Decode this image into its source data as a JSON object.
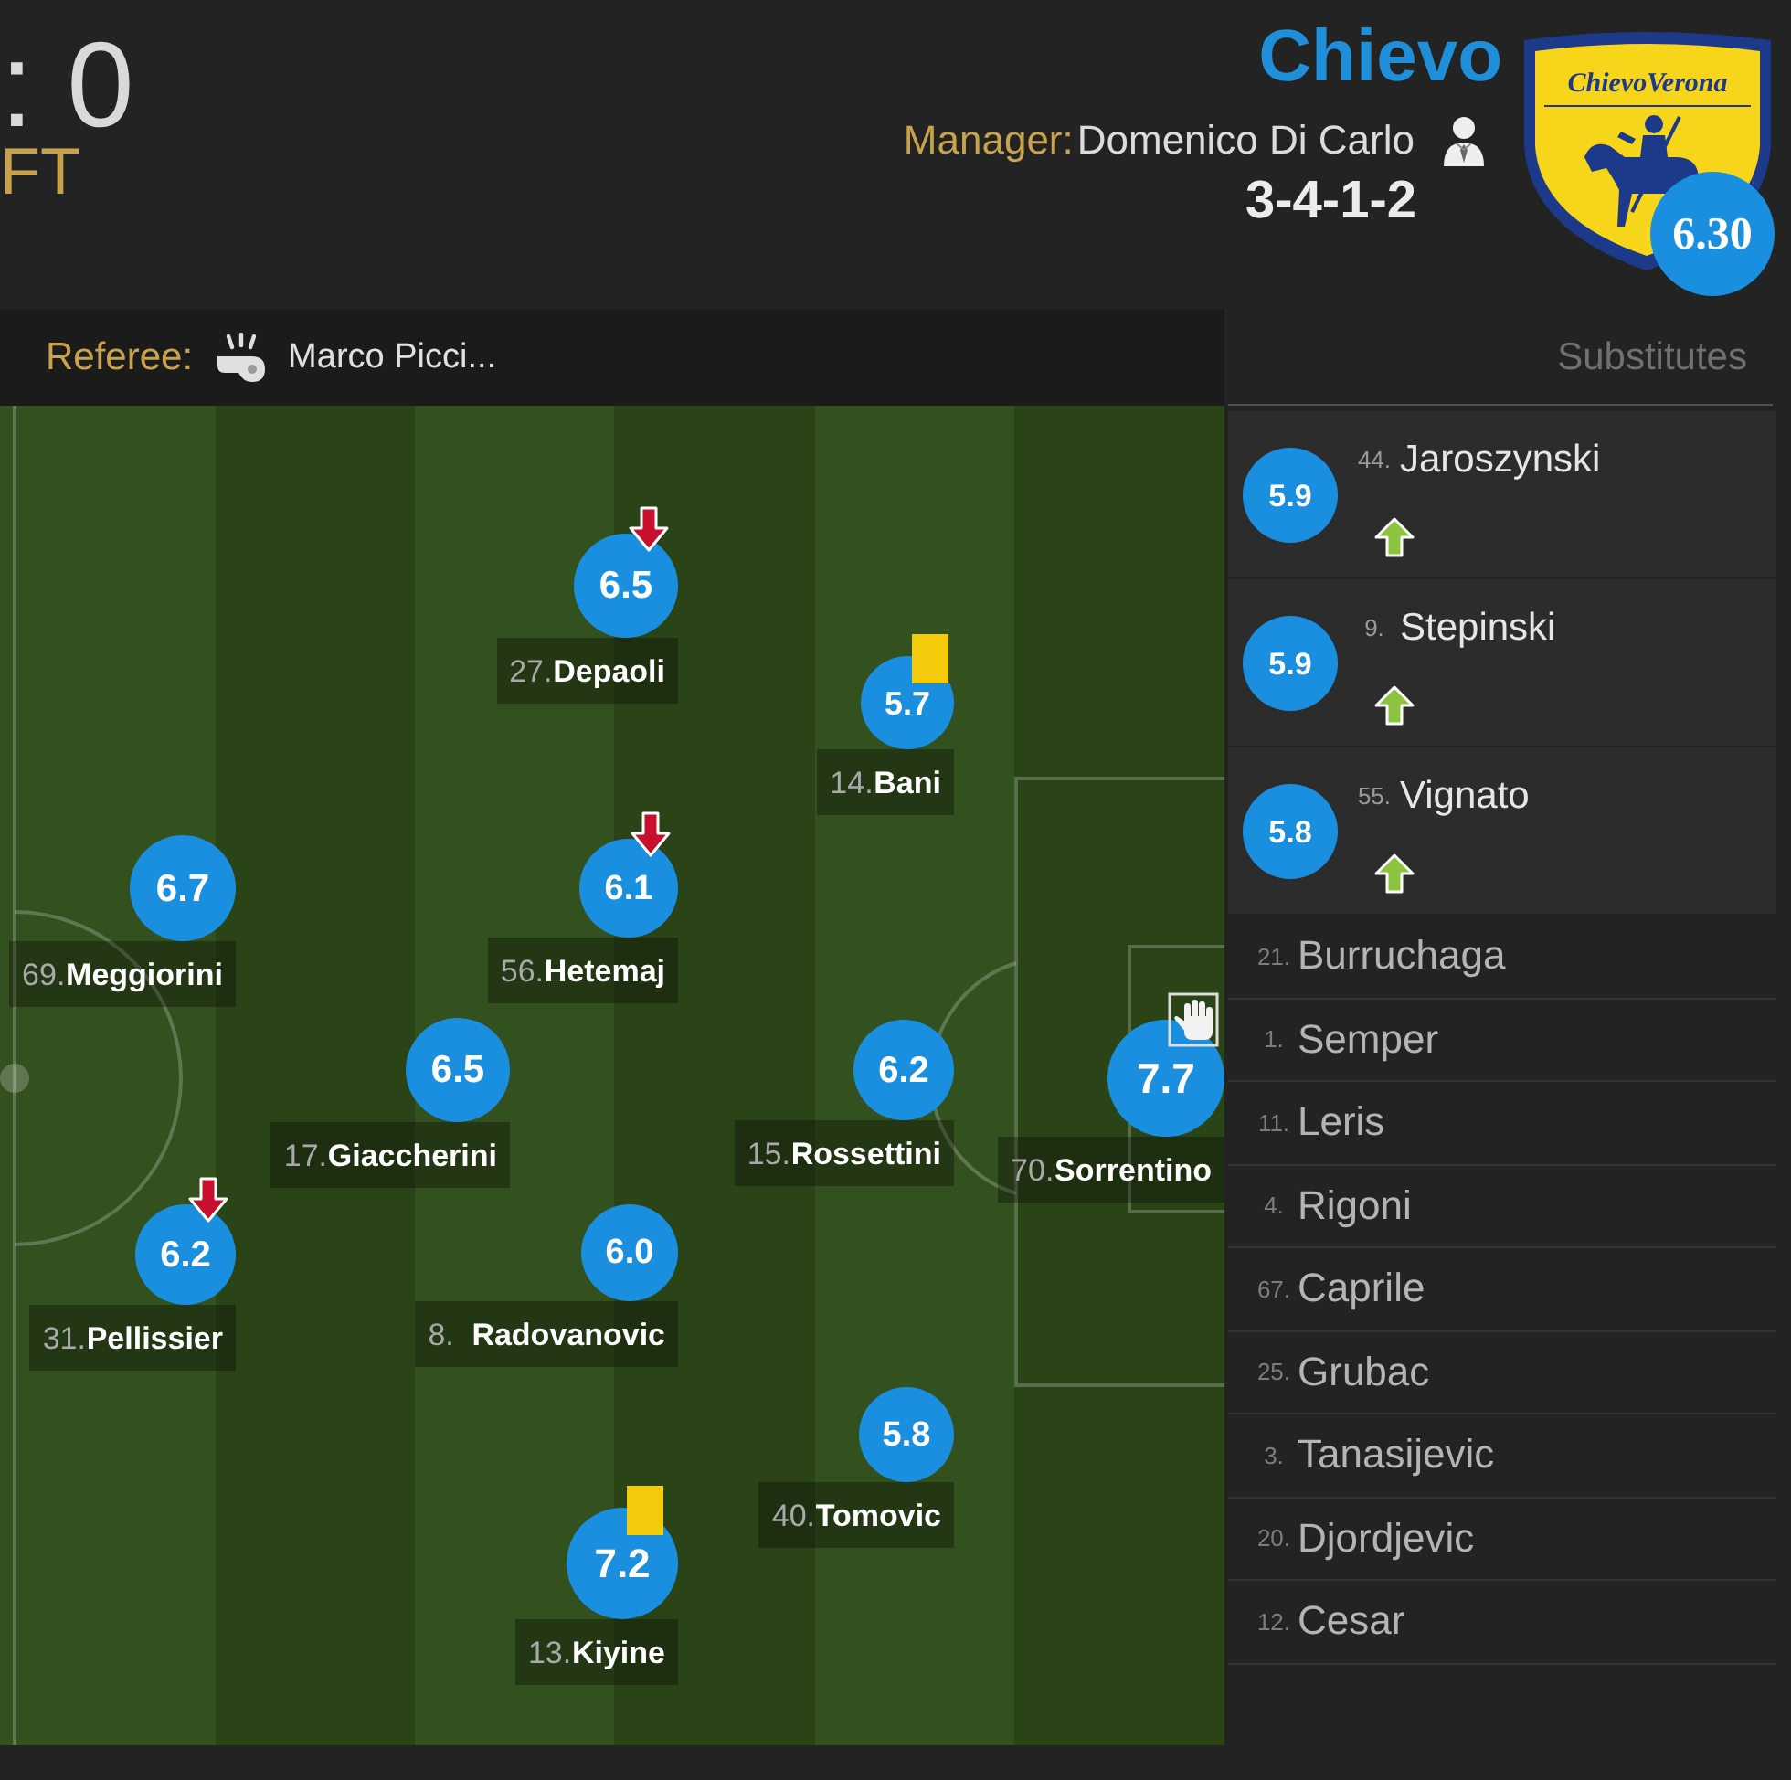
{
  "match": {
    "score": ": 0",
    "status": "FT"
  },
  "team": {
    "name": "Chievo",
    "manager_label": "Manager:",
    "manager": "Domenico Di Carlo",
    "formation": "3-4-1-2",
    "crest_text": "ChievoVerona",
    "rating": "6.30"
  },
  "referee": {
    "label": "Referee:",
    "name": "Marco Picci..."
  },
  "lineup": [
    {
      "number": "27.",
      "name": "Depaoli",
      "rating": "6.5",
      "subbed_off": true,
      "yellow_card": false,
      "goalkeeper": false
    },
    {
      "number": "14.",
      "name": "Bani",
      "rating": "5.7",
      "subbed_off": false,
      "yellow_card": true,
      "goalkeeper": false
    },
    {
      "number": "69.",
      "name": "Meggiorini",
      "rating": "6.7",
      "subbed_off": false,
      "yellow_card": false,
      "goalkeeper": false
    },
    {
      "number": "56.",
      "name": "Hetemaj",
      "rating": "6.1",
      "subbed_off": true,
      "yellow_card": false,
      "goalkeeper": false
    },
    {
      "number": "17.",
      "name": "Giaccherini",
      "rating": "6.5",
      "subbed_off": false,
      "yellow_card": false,
      "goalkeeper": false
    },
    {
      "number": "15.",
      "name": "Rossettini",
      "rating": "6.2",
      "subbed_off": false,
      "yellow_card": false,
      "goalkeeper": false
    },
    {
      "number": "70.",
      "name": "Sorrentino",
      "rating": "7.7",
      "subbed_off": false,
      "yellow_card": false,
      "goalkeeper": true
    },
    {
      "number": "31.",
      "name": "Pellissier",
      "rating": "6.2",
      "subbed_off": true,
      "yellow_card": false,
      "goalkeeper": false
    },
    {
      "number": "8.",
      "name": "Radovanovic",
      "rating": "6.0",
      "subbed_off": false,
      "yellow_card": false,
      "goalkeeper": false
    },
    {
      "number": "40.",
      "name": "Tomovic",
      "rating": "5.8",
      "subbed_off": false,
      "yellow_card": false,
      "goalkeeper": false
    },
    {
      "number": "13.",
      "name": "Kiyine",
      "rating": "7.2",
      "subbed_off": false,
      "yellow_card": true,
      "goalkeeper": false
    }
  ],
  "substitutes": {
    "title": "Substitutes",
    "players": [
      {
        "number": "44.",
        "name": "Jaroszynski",
        "rating": "5.9",
        "subbed_on": true
      },
      {
        "number": "9.",
        "name": "Stepinski",
        "rating": "5.9",
        "subbed_on": true
      },
      {
        "number": "55.",
        "name": "Vignato",
        "rating": "5.8",
        "subbed_on": true
      },
      {
        "number": "21.",
        "name": "Burruchaga",
        "subbed_on": false
      },
      {
        "number": "1.",
        "name": "Semper",
        "subbed_on": false
      },
      {
        "number": "11.",
        "name": "Leris",
        "subbed_on": false
      },
      {
        "number": "4.",
        "name": "Rigoni",
        "subbed_on": false
      },
      {
        "number": "67.",
        "name": "Caprile",
        "subbed_on": false
      },
      {
        "number": "25.",
        "name": "Grubac",
        "subbed_on": false
      },
      {
        "number": "3.",
        "name": "Tanasijevic",
        "subbed_on": false
      },
      {
        "number": "20.",
        "name": "Djordjevic",
        "subbed_on": false
      },
      {
        "number": "12.",
        "name": "Cesar",
        "subbed_on": false
      }
    ]
  }
}
